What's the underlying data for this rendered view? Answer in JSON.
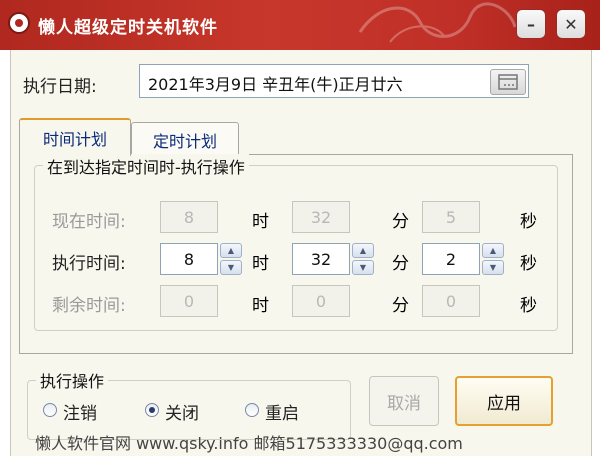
{
  "window": {
    "title": "懒人超级定时关机软件",
    "minimize_symbol": "–",
    "close_symbol": "✕"
  },
  "date": {
    "label": "执行日期:",
    "value": "2021年3月9日  辛丑年(牛)正月廿六"
  },
  "tabs": [
    {
      "label": "时间计划",
      "active": true
    },
    {
      "label": "定时计划",
      "active": false
    }
  ],
  "time_group": {
    "title": "在到达指定时间时-执行操作",
    "rows": [
      {
        "label": "现在时间:",
        "hour": "8",
        "minute": "32",
        "second": "5",
        "editable": false
      },
      {
        "label": "执行时间:",
        "hour": "8",
        "minute": "32",
        "second": "2",
        "editable": true
      },
      {
        "label": "剩余时间:",
        "hour": "0",
        "minute": "0",
        "second": "0",
        "editable": false
      }
    ],
    "units": {
      "hour": "时",
      "minute": "分",
      "second": "秒"
    }
  },
  "action_group": {
    "title": "执行操作",
    "options": [
      {
        "label": "注销",
        "checked": false
      },
      {
        "label": "关闭",
        "checked": true
      },
      {
        "label": "重启",
        "checked": false
      }
    ]
  },
  "buttons": {
    "cancel": "取消",
    "apply": "应用"
  },
  "footer": {
    "text": "懒人软件官网 www.qsky.info 邮箱5175333330@qq.com"
  },
  "colors": {
    "titlebar": "#c03028",
    "accent_border": "#e6a030",
    "tab_text": "#0a2a7a"
  }
}
